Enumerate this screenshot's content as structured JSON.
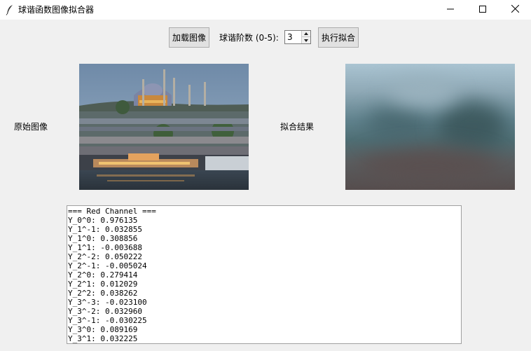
{
  "window": {
    "title": "球谐函数图像拟合器"
  },
  "toolbar": {
    "load_label": "加载图像",
    "degree_label": "球谐阶数 (0-5):",
    "degree_value": "3",
    "fit_label": "执行拟合"
  },
  "images": {
    "original_label": "原始图像",
    "result_label": "拟合结果"
  },
  "output": {
    "lines": [
      "=== Red Channel ===",
      "Y_0^0: 0.976135",
      "Y_1^-1: 0.032855",
      "Y_1^0: 0.308856",
      "Y_1^1: -0.003688",
      "Y_2^-2: 0.050222",
      "Y_2^-1: -0.005024",
      "Y_2^0: 0.279414",
      "Y_2^1: 0.012029",
      "Y_2^2: 0.038262",
      "Y_3^-3: -0.023100",
      "Y_3^-2: 0.032960",
      "Y_3^-1: -0.030225",
      "Y_3^0: 0.089169",
      "Y_3^1: 0.032225"
    ]
  }
}
